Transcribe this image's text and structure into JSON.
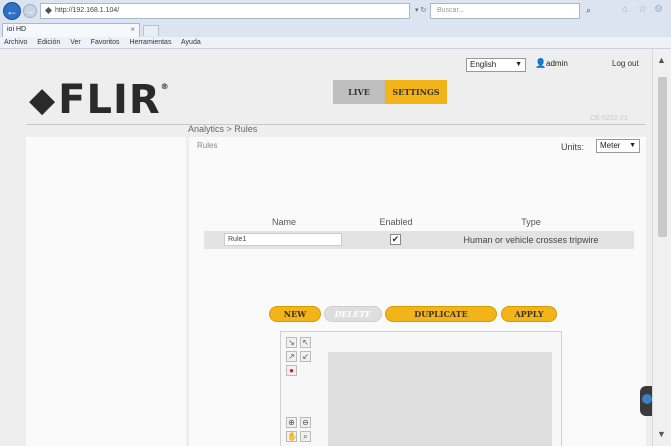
{
  "browser": {
    "url": "http://192.168.1.104/",
    "search_placeholder": "Buscar...",
    "tab_title": "ioi HD",
    "tab_close": "×",
    "menu": [
      "Archivo",
      "Edición",
      "Ver",
      "Favoritos",
      "Herramientas",
      "Ayuda"
    ],
    "back_icon": "←",
    "fwd_icon": "→"
  },
  "header": {
    "logo_text": "FLIR",
    "logo_mark": "◆",
    "logo_reg": "®",
    "language": "English",
    "username": "admin",
    "logout": "Log out",
    "mode_live": "LIVE",
    "mode_settings": "SETTINGS",
    "model": "CB-5222-21"
  },
  "breadcrumb": "Analytics > Rules",
  "rules": {
    "title": "Rules",
    "units_label": "Units:",
    "units_value": "Meter",
    "columns": [
      "Name",
      "Enabled",
      "Type"
    ],
    "rows": [
      {
        "name": "Rule1",
        "enabled": "✔",
        "type": "Human or vehicle crosses tripwire"
      }
    ]
  },
  "buttons": {
    "new": "NEW",
    "delete": "DELETE",
    "duplicate": "DUPLICATE",
    "apply": "APPLY"
  },
  "colors": {
    "accent": "#f3b419",
    "chrome": "#dbe4f0"
  }
}
